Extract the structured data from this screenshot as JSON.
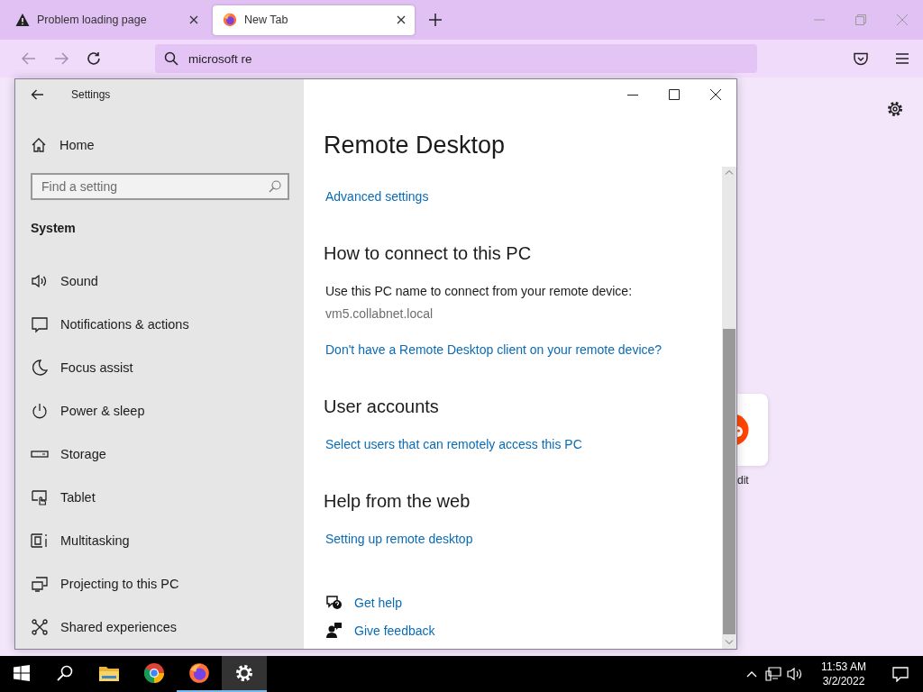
{
  "browser": {
    "tabs": [
      {
        "title": "Problem loading page",
        "kind": "warning",
        "selected": false
      },
      {
        "title": "New Tab",
        "kind": "firefox",
        "selected": true
      }
    ],
    "address": {
      "value": "microsoft re"
    },
    "shortcut": {
      "label": "dit"
    }
  },
  "settings": {
    "title": "Settings",
    "home": "Home",
    "search": {
      "placeholder": "Find a setting"
    },
    "category": "System",
    "nav": [
      {
        "label": "Sound",
        "kind": "sound"
      },
      {
        "label": "Notifications & actions",
        "kind": "notifications"
      },
      {
        "label": "Focus assist",
        "kind": "focus"
      },
      {
        "label": "Power & sleep",
        "kind": "power"
      },
      {
        "label": "Storage",
        "kind": "storage"
      },
      {
        "label": "Tablet",
        "kind": "tablet"
      },
      {
        "label": "Multitasking",
        "kind": "multitasking"
      },
      {
        "label": "Projecting to this PC",
        "kind": "projecting"
      },
      {
        "label": "Shared experiences",
        "kind": "shared"
      }
    ],
    "page_title": "Remote Desktop",
    "blocks": [
      {
        "kind": "link",
        "text": "Advanced settings"
      },
      {
        "kind": "heading",
        "text": "How to connect to this PC"
      },
      {
        "kind": "text",
        "text": "Use this PC name to connect from your remote device:"
      },
      {
        "kind": "value",
        "text": "vm5.collabnet.local"
      },
      {
        "kind": "link",
        "text": "Don't have a Remote Desktop client on your remote device?"
      },
      {
        "kind": "heading",
        "text": "User accounts"
      },
      {
        "kind": "link",
        "text": "Select users that can remotely access this PC"
      },
      {
        "kind": "heading",
        "text": "Help from the web"
      },
      {
        "kind": "link",
        "text": "Setting up remote desktop"
      }
    ],
    "help": [
      {
        "label": "Get help",
        "kind": "help"
      },
      {
        "label": "Give feedback",
        "kind": "feedback"
      }
    ]
  },
  "taskbar": {
    "apps": [
      {
        "kind": "start",
        "running": false,
        "active": false
      },
      {
        "kind": "search",
        "running": false,
        "active": false
      },
      {
        "kind": "explorer",
        "running": false,
        "active": false
      },
      {
        "kind": "chrome",
        "running": false,
        "active": false
      },
      {
        "kind": "firefox",
        "running": true,
        "active": false
      },
      {
        "kind": "settings",
        "running": true,
        "active": true
      }
    ],
    "time": "11:53 AM",
    "date": "3/2/2022"
  }
}
